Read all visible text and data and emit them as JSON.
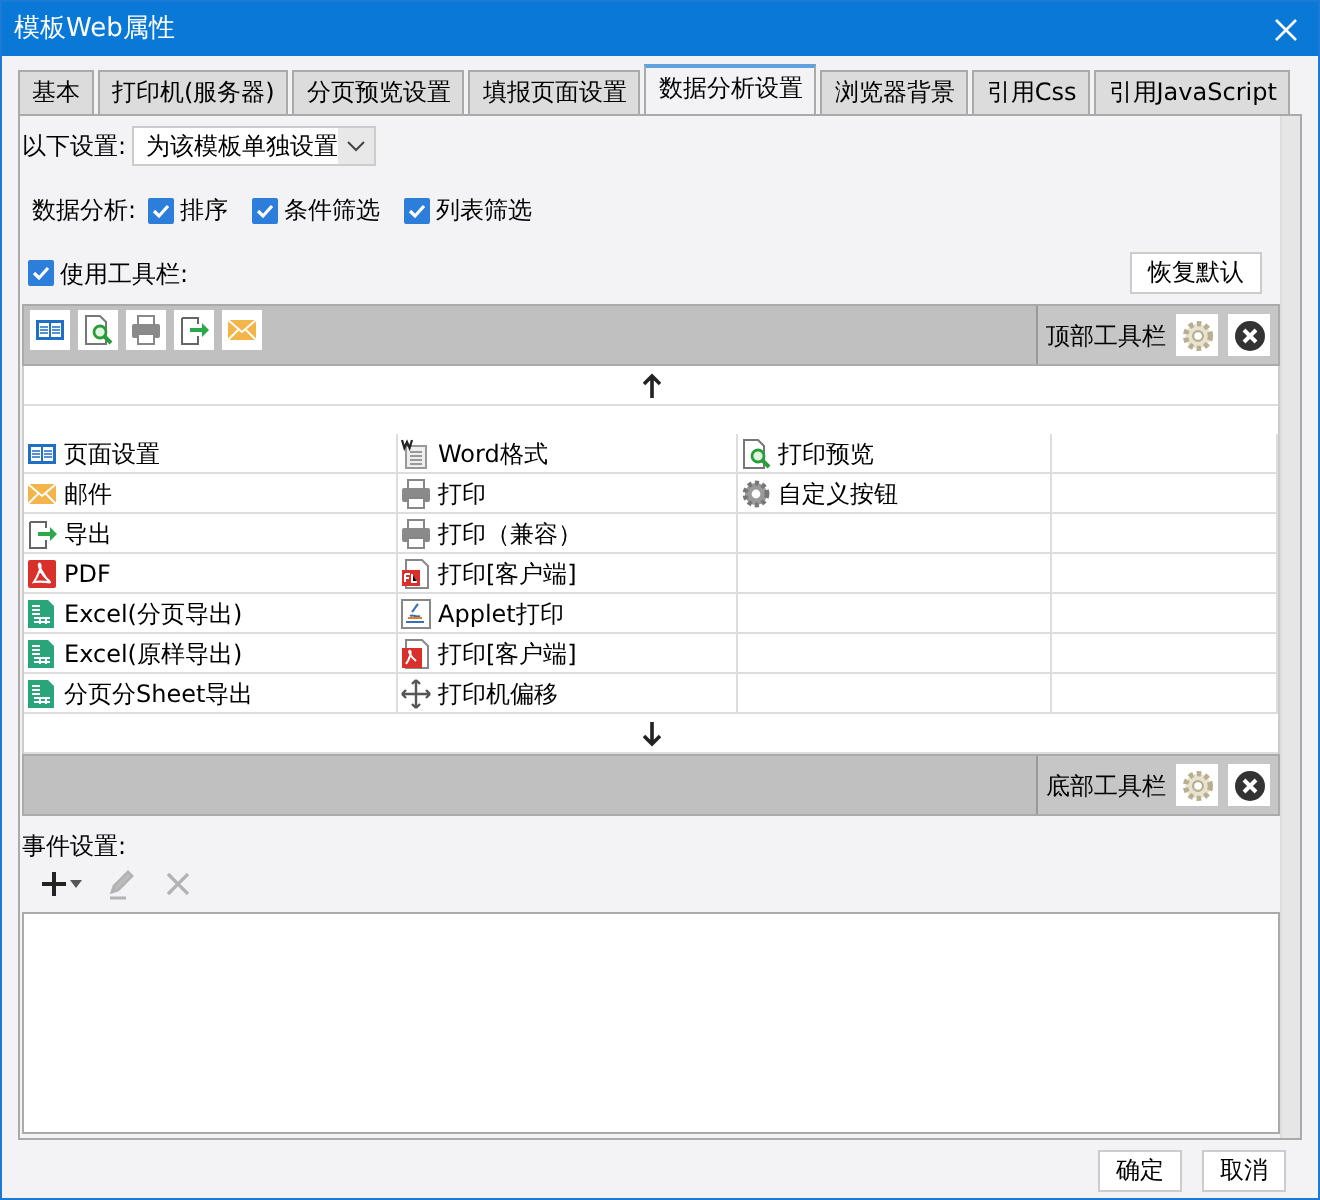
{
  "window": {
    "title": "模板Web属性"
  },
  "tabs": [
    {
      "label": "基本",
      "selected": false
    },
    {
      "label": "打印机(服务器)",
      "selected": false
    },
    {
      "label": "分页预览设置",
      "selected": false
    },
    {
      "label": "填报页面设置",
      "selected": false
    },
    {
      "label": "数据分析设置",
      "selected": true
    },
    {
      "label": "浏览器背景",
      "selected": false
    },
    {
      "label": "引用Css",
      "selected": false
    },
    {
      "label": "引用JavaScript",
      "selected": false
    }
  ],
  "scope": {
    "label": "以下设置:",
    "value": "为该模板单独设置"
  },
  "data_analysis": {
    "label": "数据分析:",
    "options": [
      {
        "label": "排序",
        "checked": true
      },
      {
        "label": "条件筛选",
        "checked": true
      },
      {
        "label": "列表筛选",
        "checked": true
      }
    ]
  },
  "use_toolbar": {
    "label": "使用工具栏:",
    "checked": true
  },
  "restore_button": "恢复默认",
  "top_toolbar": {
    "label": "顶部工具栏",
    "items": [
      {
        "kind": "book"
      },
      {
        "kind": "preview"
      },
      {
        "kind": "print"
      },
      {
        "kind": "export"
      },
      {
        "kind": "mail"
      }
    ]
  },
  "available_buttons": [
    [
      {
        "label": "页面设置",
        "kind": "book"
      },
      {
        "label": "Word格式",
        "kind": "word"
      },
      {
        "label": "打印预览",
        "kind": "preview"
      }
    ],
    [
      {
        "label": "邮件",
        "kind": "mail"
      },
      {
        "label": "打印",
        "kind": "print"
      },
      {
        "label": "自定义按钮",
        "kind": "gear"
      }
    ],
    [
      {
        "label": "导出",
        "kind": "export"
      },
      {
        "label": "打印（兼容）",
        "kind": "print"
      }
    ],
    [
      {
        "label": "PDF",
        "kind": "pdf"
      },
      {
        "label": "打印[客户端]",
        "kind": "flash"
      }
    ],
    [
      {
        "label": "Excel(分页导出)",
        "kind": "excel"
      },
      {
        "label": "Applet打印",
        "kind": "applet"
      }
    ],
    [
      {
        "label": "Excel(原样导出)",
        "kind": "excel"
      },
      {
        "label": "打印[客户端]",
        "kind": "pdfdoc"
      }
    ],
    [
      {
        "label": "分页分Sheet导出",
        "kind": "excel"
      },
      {
        "label": "打印机偏移",
        "kind": "move"
      }
    ]
  ],
  "bottom_toolbar": {
    "label": "底部工具栏"
  },
  "events": {
    "label": "事件设置:",
    "tools": [
      {
        "kind": "add",
        "disabled": false
      },
      {
        "kind": "edit",
        "disabled": true
      },
      {
        "kind": "delete",
        "disabled": true
      }
    ]
  },
  "footer_buttons": [
    "确定",
    "取消"
  ]
}
